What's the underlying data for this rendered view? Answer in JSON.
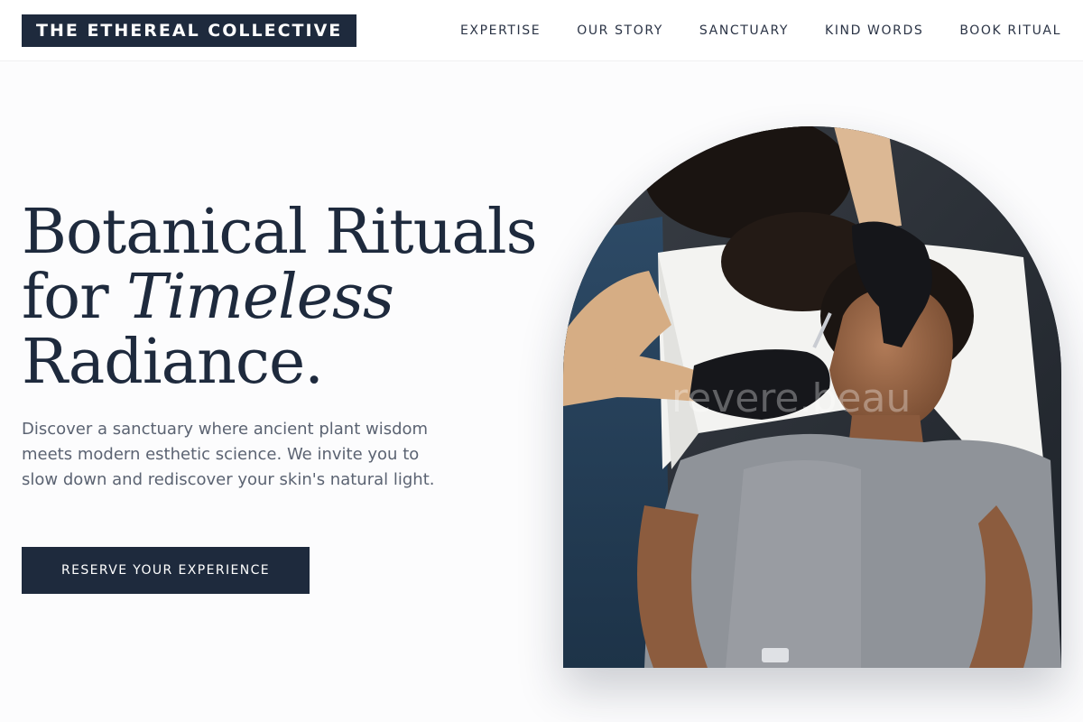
{
  "brand": {
    "name": "THE ETHEREAL COLLECTIVE"
  },
  "nav": {
    "items": [
      {
        "label": "EXPERTISE"
      },
      {
        "label": "OUR STORY"
      },
      {
        "label": "SANCTUARY"
      },
      {
        "label": "KIND WORDS"
      },
      {
        "label": "BOOK RITUAL"
      }
    ]
  },
  "hero": {
    "headline": {
      "line1": "Botanical Rituals",
      "line2_prefix": "for ",
      "line2_emphasis": "Timeless",
      "line3": "Radiance."
    },
    "lead": "Discover a sanctuary where ancient plant wisdom meets modern esthetic science. We invite you to slow down and rediscover your skin's natural light.",
    "cta_label": "RESERVE YOUR EXPERIENCE",
    "image": {
      "alt": "Esthetician with black gloves performing a facial treatment on a client lying on a white towel",
      "watermark": "revere.beau"
    }
  },
  "colors": {
    "navy": "#1e2a3d",
    "body_text": "#5b6372",
    "background": "#fcfcfd"
  }
}
